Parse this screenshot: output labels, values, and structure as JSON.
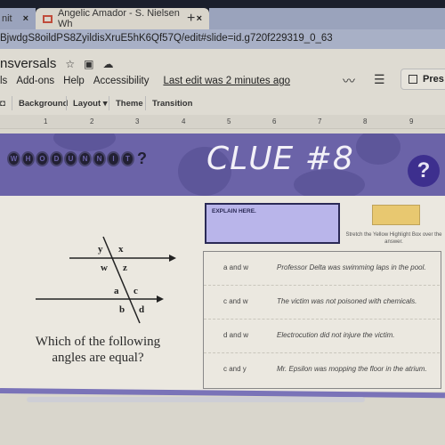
{
  "browser": {
    "tabs": [
      {
        "label": "nit",
        "close": "×"
      },
      {
        "label": "Angelic Amador - S. Nielsen Wh",
        "close": "×"
      }
    ],
    "new_tab": "+",
    "url": "BjwdgS8oildPS8ZyildisXruE5hK6Qf57Q/edit#slide=id.g720f229319_0_63"
  },
  "app": {
    "title": "nsversals",
    "title_icons": [
      "star-icon",
      "folder-icon",
      "cloud-icon"
    ],
    "menu": [
      "ls",
      "Add-ons",
      "Help",
      "Accessibility"
    ],
    "last_edit": "Last edit was 2 minutes ago",
    "present_label": "Pres"
  },
  "toolbar": {
    "items": [
      "Background",
      "Layout ▾",
      "Theme",
      "Transition"
    ]
  },
  "ruler": {
    "marks": [
      "1",
      "2",
      "3",
      "4",
      "5",
      "6",
      "7",
      "8",
      "9"
    ]
  },
  "slide": {
    "logo_letters": [
      "W",
      "H",
      "O",
      "D",
      "U",
      "N",
      "N",
      "I",
      "T"
    ],
    "logo_suffix": "?",
    "clue_title": "CLUE #8",
    "help_symbol": "?",
    "diagram_labels": {
      "y": "y",
      "x": "x",
      "w": "w",
      "z": "z",
      "a": "a",
      "c": "c",
      "b": "b",
      "d": "d"
    },
    "question": "Which of the following angles are equal?",
    "explain_label": "EXPLAIN HERE.",
    "highlight_instruction": "Stretch the Yellow Highlight Box over the answer.",
    "highlight_color": "#e8c870",
    "options": [
      {
        "angles": "a and w",
        "clue": "Professor Delta was swimming laps in the pool."
      },
      {
        "angles": "c and w",
        "clue": "The victim was not poisoned with chemicals."
      },
      {
        "angles": "d and w",
        "clue": "Electrocution did not injure the victim."
      },
      {
        "angles": "c and y",
        "clue": "Mr. Epsilon was mopping the floor in the atrium."
      }
    ]
  }
}
